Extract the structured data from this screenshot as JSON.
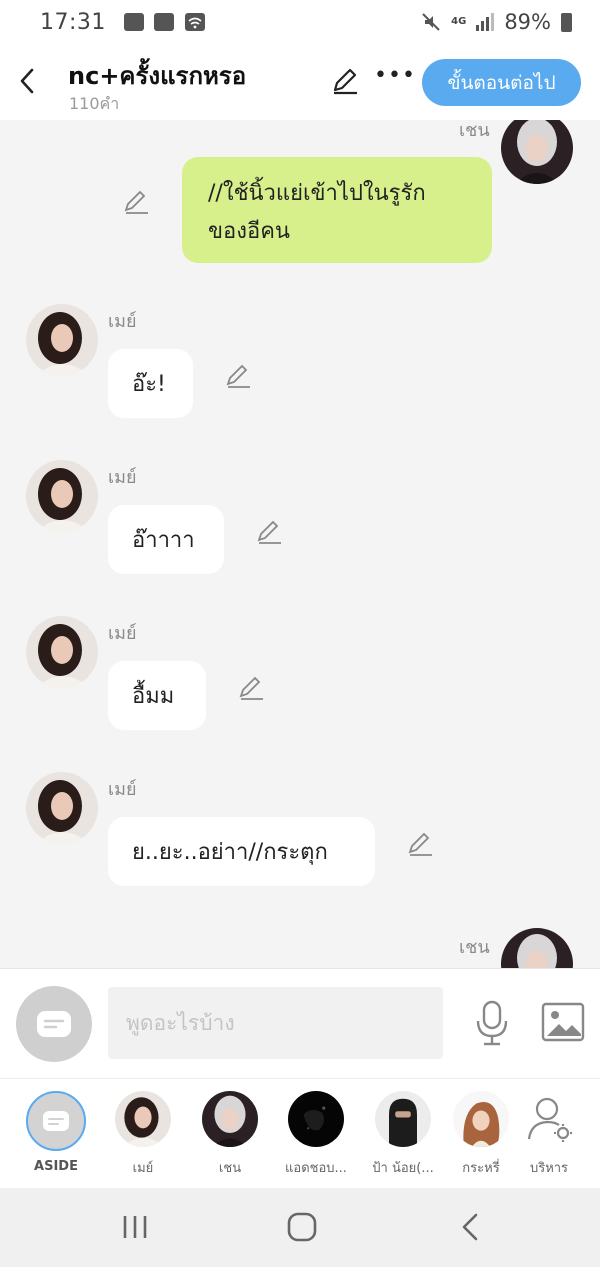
{
  "status_bar": {
    "time": "17:31",
    "network": "4G",
    "battery": "89%"
  },
  "header": {
    "title": "nc+ครั้งแรกหรอ",
    "word_count": "110คำ",
    "next_button": "ขั้นตอนต่อไป"
  },
  "chat": {
    "messages": [
      {
        "sender": "เชน",
        "text": "//ใช้นิ้วแย่เข้าไปในรูรัก\nของอีคน"
      },
      {
        "sender": "เมย์",
        "text": "อ๊ะ!"
      },
      {
        "sender": "เมย์",
        "text": "อ๊าาาา"
      },
      {
        "sender": "เมย์",
        "text": "อื้มม"
      },
      {
        "sender": "เมย์",
        "text": "ย..ยะ..อย่าา//กระตุก"
      },
      {
        "sender": "เชน",
        "text": ""
      }
    ]
  },
  "input": {
    "placeholder": "พูดอะไรบ้าง"
  },
  "characters": [
    {
      "label": "ASIDE"
    },
    {
      "label": "เมย์"
    },
    {
      "label": "เชน"
    },
    {
      "label": "แอดชอบ..."
    },
    {
      "label": "ป้า น้อย(..."
    },
    {
      "label": "กระหรี่"
    },
    {
      "label": "บริหาร"
    }
  ],
  "colors": {
    "accent": "#5aaaf0",
    "own_bubble": "#d8f08c",
    "background": "#f4f4f4"
  }
}
